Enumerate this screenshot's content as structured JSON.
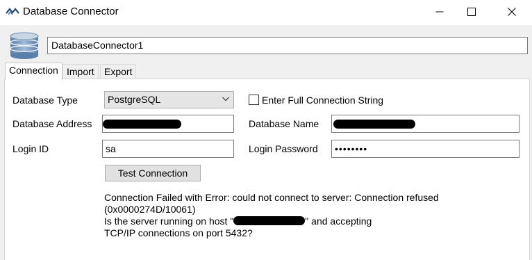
{
  "window": {
    "title": "Database Connector",
    "minimize_icon": "minimize-icon",
    "maximize_icon": "maximize-icon",
    "close_icon": "close-icon"
  },
  "connector_name": "DatabaseConnector1",
  "tabs": [
    {
      "label": "Connection",
      "active": true
    },
    {
      "label": "Import",
      "active": false
    },
    {
      "label": "Export",
      "active": false
    }
  ],
  "connection": {
    "db_type_label": "Database Type",
    "db_type_value": "PostgreSQL",
    "full_string_label": "Enter Full Connection String",
    "full_string_checked": false,
    "db_address_label": "Database Address",
    "db_name_label": "Database Name",
    "login_id_label": "Login ID",
    "login_id_value": "sa",
    "login_password_label": "Login Password",
    "login_password_value": "••••••••",
    "test_button_label": "Test Connection"
  },
  "error": {
    "line1": "Connection Failed with Error: could not connect to server: Connection refused",
    "line2": "(0x0000274D/10061)",
    "line3_prefix": "Is the server running on host \"",
    "line3_suffix": "\" and accepting",
    "line4": "TCP/IP connections on port 5432?"
  }
}
